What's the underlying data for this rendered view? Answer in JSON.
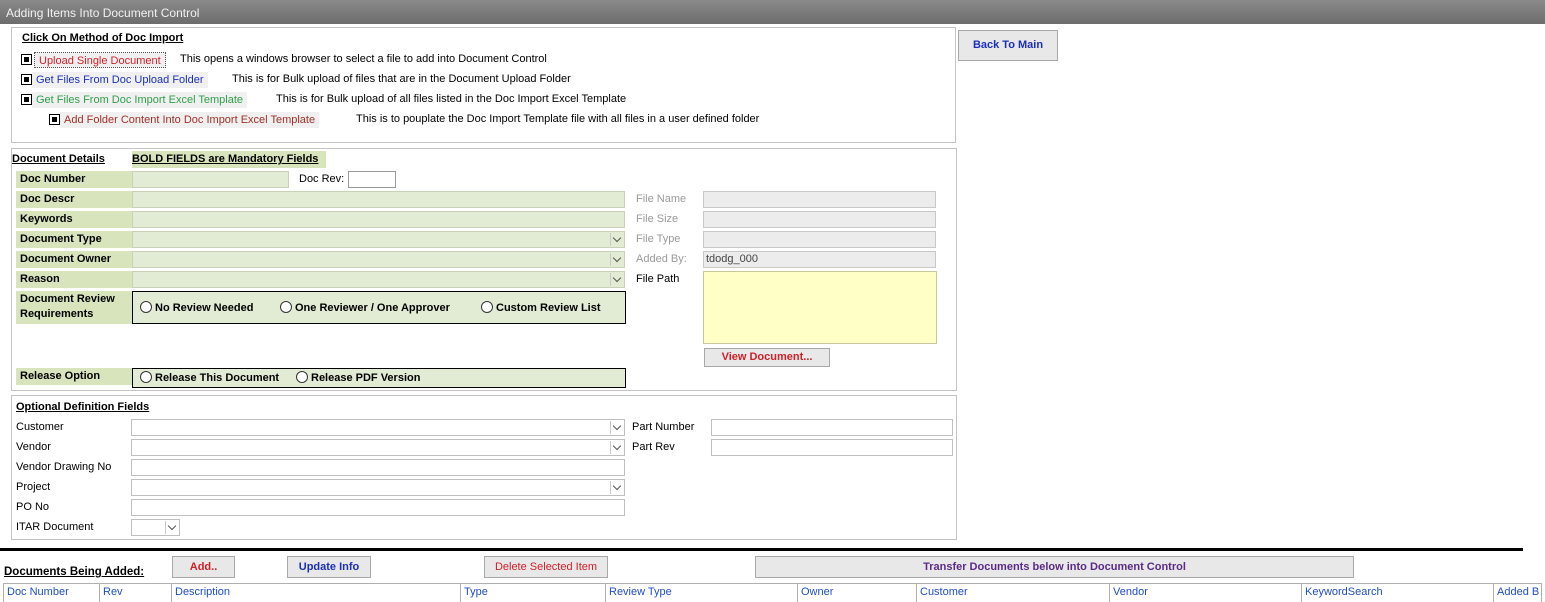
{
  "window": {
    "title": "Adding Items Into Document Control"
  },
  "import_methods": {
    "heading": "Click On Method of Doc Import",
    "items": [
      {
        "label": "Upload Single Document",
        "description": "This opens a windows browser to select a file to add into Document Control",
        "color": "#d0202a"
      },
      {
        "label": "Get Files From Doc Upload Folder",
        "description": "This is for Bulk upload of files that are in the Document Upload Folder",
        "color": "#1c2fb8"
      },
      {
        "label": "Get Files From Doc Import Excel Template",
        "description": "This is for Bulk upload of all files listed in the Doc Import Excel Template",
        "color": "#2ea04a"
      },
      {
        "label": "Add Folder Content Into Doc Import Excel Template",
        "description": "This is to pouplate the Doc Import Template file with all files in a user defined folder",
        "color": "#a0302a"
      }
    ]
  },
  "back_button": {
    "label": "Back To Main"
  },
  "details": {
    "heading": "Document Details",
    "mandatory_note": "BOLD FIELDS are Mandatory Fields",
    "doc_number": {
      "label": "Doc Number",
      "value": ""
    },
    "doc_rev": {
      "label": "Doc Rev:",
      "value": ""
    },
    "doc_descr": {
      "label": "Doc Descr",
      "value": ""
    },
    "keywords": {
      "label": "Keywords",
      "value": ""
    },
    "document_type": {
      "label": "Document Type",
      "value": ""
    },
    "document_owner": {
      "label": "Document Owner",
      "value": ""
    },
    "reason": {
      "label": "Reason",
      "value": ""
    },
    "review": {
      "label_line1": "Document Review",
      "label_line2": "Requirements",
      "options": [
        "No Review Needed",
        "One Reviewer / One Approver",
        "Custom Review List"
      ]
    },
    "release": {
      "label": "Release Option",
      "options": [
        "Release This Document",
        "Release PDF Version"
      ]
    },
    "file_name": {
      "label": "File Name",
      "value": ""
    },
    "file_size": {
      "label": "File Size",
      "value": ""
    },
    "file_type": {
      "label": "File Type",
      "value": ""
    },
    "added_by": {
      "label": "Added By:",
      "value": "tdodg_000"
    },
    "file_path": {
      "label": "File Path",
      "value": ""
    },
    "view_button": {
      "label": "View Document..."
    }
  },
  "optional": {
    "heading": "Optional Definition Fields",
    "customer": {
      "label": "Customer",
      "value": ""
    },
    "vendor": {
      "label": "Vendor",
      "value": ""
    },
    "vendor_drawing": {
      "label": "Vendor Drawing No",
      "value": ""
    },
    "project": {
      "label": "Project",
      "value": ""
    },
    "po_no": {
      "label": "PO No",
      "value": ""
    },
    "itar": {
      "label": "ITAR Document",
      "value": ""
    },
    "part_number": {
      "label": "Part Number",
      "value": ""
    },
    "part_rev": {
      "label": "Part Rev",
      "value": ""
    }
  },
  "bottom": {
    "heading": "Documents Being Added:",
    "add_button": "Add..",
    "update_button": "Update Info",
    "delete_button": "Delete Selected Item",
    "transfer_button": "Transfer Documents below into Document Control",
    "columns": [
      "Doc Number",
      "Rev",
      "Description",
      "Type",
      "Review Type",
      "Owner",
      "Customer",
      "Vendor",
      "KeywordSearch",
      "Added B"
    ]
  },
  "colors": {
    "mandatory_label_bg": "#d8e4bc",
    "field_green": "#e2ebd3",
    "file_path_yellow": "#ffffc6",
    "grid_header_text": "#1f4fc1",
    "delete_red": "#d0202a",
    "transfer_purple": "#5b2a86"
  }
}
